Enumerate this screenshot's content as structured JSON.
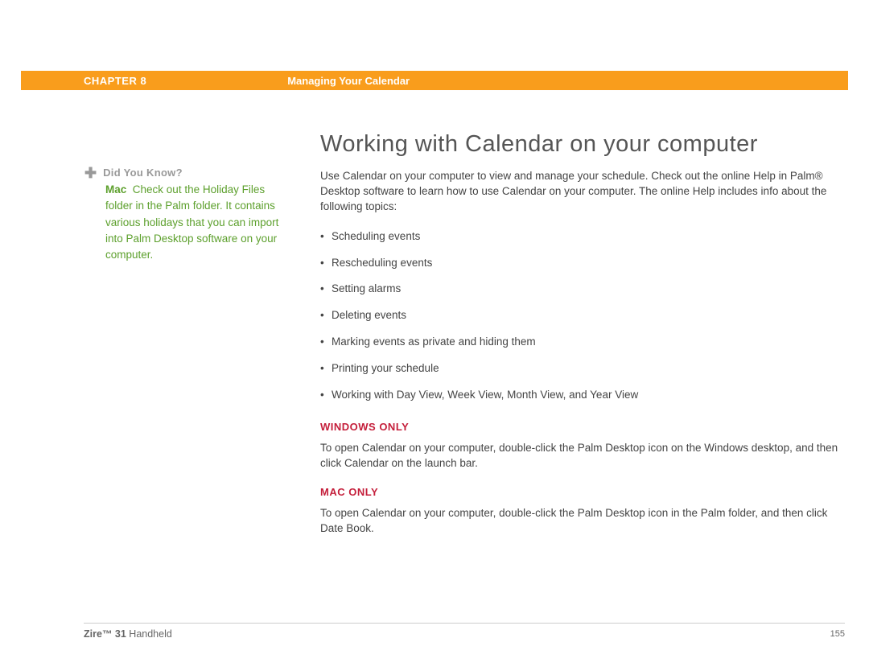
{
  "header": {
    "chapter_label": "CHAPTER 8",
    "chapter_title": "Managing Your Calendar"
  },
  "sidebar": {
    "heading": "Did You Know?",
    "mac_label": "Mac",
    "tip_text": "Check out the Holiday Files folder in the Palm folder. It contains various holidays that you can import into Palm Desktop software on your computer."
  },
  "main": {
    "title": "Working with Calendar on your computer",
    "intro": "Use Calendar on your computer to view and manage your schedule. Check out the online Help in Palm® Desktop software to learn how to use Calendar on your computer. The online Help includes info about the following topics:",
    "bullets": [
      "Scheduling events",
      "Rescheduling events",
      "Setting alarms",
      "Deleting events",
      "Marking events as private and hiding them",
      "Printing your schedule",
      "Working with Day View, Week View, Month View, and Year View"
    ],
    "windows_label": "WINDOWS ONLY",
    "windows_text": "To open Calendar on your computer, double-click the Palm Desktop icon on the Windows desktop, and then click Calendar on the launch bar.",
    "mac_label": "MAC ONLY",
    "mac_text": "To open Calendar on your computer, double-click the Palm Desktop icon in the Palm folder, and then click Date Book."
  },
  "footer": {
    "product_bold": "Zire™ 31",
    "product_rest": " Handheld",
    "page_number": "155"
  }
}
